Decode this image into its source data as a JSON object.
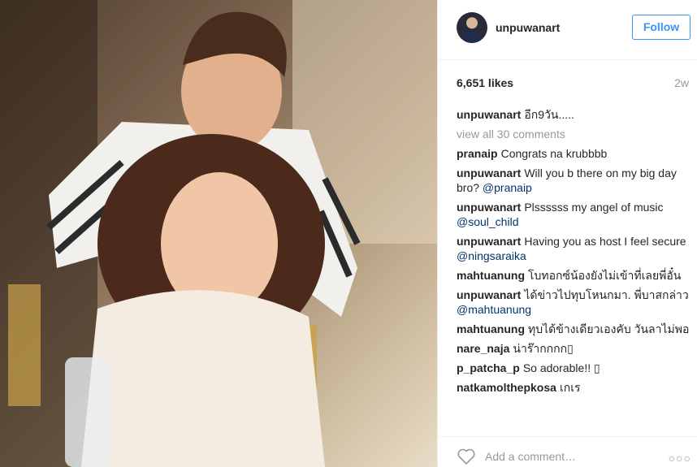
{
  "post": {
    "username": "unpuwanart",
    "follow_label": "Follow",
    "likes": "6,651 likes",
    "time": "2w",
    "view_all": "view all 30 comments",
    "add_comment_placeholder": "Add a comment…",
    "more": "○○○"
  },
  "comments": [
    {
      "user": "unpuwanart",
      "text": "อีก9วัน.....",
      "mention": ""
    },
    {
      "user": "pranaip",
      "text": "Congrats na krubbbb",
      "mention": ""
    },
    {
      "user": "unpuwanart",
      "text": "Will you b there on my big day bro?",
      "mention": "@pranaip"
    },
    {
      "user": "unpuwanart",
      "text": "Plssssss my angel of music",
      "mention": "@soul_child"
    },
    {
      "user": "unpuwanart",
      "text": "Having you as host I feel secure",
      "mention": "@ningsaraika"
    },
    {
      "user": "mahtuanung",
      "text": "โบทอกซ์น้องยังไม่เข้าที่เลยพี่อั๋น",
      "mention": ""
    },
    {
      "user": "unpuwanart",
      "text": "ได้ข่าวไปทุบโหนกมา. พี่บาสกล่าว",
      "mention": "@mahtuanung"
    },
    {
      "user": "mahtuanung",
      "text": "ทุบได้ข้างเดียวเองคับ วันลาไม่พอ",
      "mention": ""
    },
    {
      "user": "nare_naja",
      "text": "น่าร๊ากกกก▯",
      "mention": ""
    },
    {
      "user": "p_patcha_p",
      "text": "So adorable!! ▯",
      "mention": ""
    },
    {
      "user": "natkamolthepkosa",
      "text": "เกเร",
      "mention": ""
    }
  ],
  "colors": {
    "accent": "#3897f0",
    "mention": "#003569",
    "muted": "#999999"
  }
}
